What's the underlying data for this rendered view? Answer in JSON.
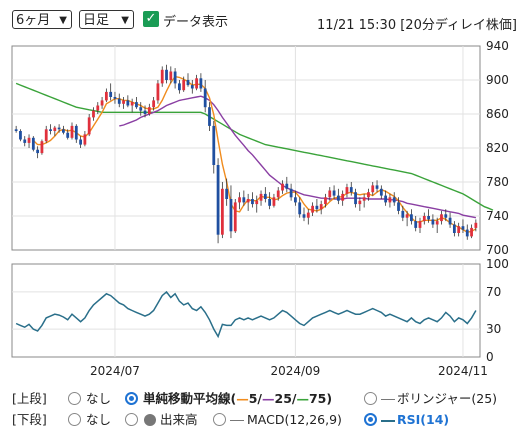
{
  "controls": {
    "period": "6ヶ月",
    "interval": "日足",
    "show_data_label": "データ表示",
    "show_data_checked": true,
    "timestamp": "11/21 15:30 [20分ディレイ株価]"
  },
  "legend": {
    "upper_label": "[上段]",
    "upper_none": "なし",
    "sma_label": "単純移動平均線(",
    "sma5": "5",
    "sma25": "25",
    "sma75": "75",
    "sma_sep1": "/",
    "sma_sep2": "/",
    "sma_close": ")",
    "bollinger": "ボリンジャー(25)",
    "lower_label": "[下段]",
    "lower_none": "なし",
    "volume": "出来高",
    "macd": "MACD(12,26,9)",
    "rsi": "RSI(14)"
  },
  "colors": {
    "up": "#e0303c",
    "down": "#1f4fa0",
    "ma5": "#f08c1e",
    "ma25": "#8a3fa3",
    "ma75": "#3aa33a",
    "rsi": "#2a6f8a",
    "accent": "#1f73d3"
  },
  "chart_data": [
    {
      "type": "candlestick",
      "y_ticks": [
        700,
        740,
        780,
        820,
        860,
        900,
        940
      ],
      "ylim": [
        700,
        940
      ],
      "x_ticks": [
        "2024/07",
        "2024/09",
        "2024/11"
      ],
      "x_tick_index": [
        23,
        65,
        104
      ],
      "candles": [
        [
          842,
          846,
          838,
          840
        ],
        [
          840,
          842,
          828,
          830
        ],
        [
          830,
          834,
          822,
          826
        ],
        [
          826,
          836,
          820,
          832
        ],
        [
          832,
          834,
          816,
          818
        ],
        [
          818,
          822,
          808,
          814
        ],
        [
          814,
          830,
          812,
          828
        ],
        [
          828,
          846,
          826,
          842
        ],
        [
          842,
          848,
          836,
          840
        ],
        [
          840,
          846,
          834,
          844
        ],
        [
          844,
          848,
          838,
          842
        ],
        [
          842,
          846,
          836,
          838
        ],
        [
          838,
          842,
          830,
          832
        ],
        [
          832,
          850,
          830,
          846
        ],
        [
          846,
          848,
          826,
          830
        ],
        [
          830,
          834,
          820,
          824
        ],
        [
          824,
          840,
          822,
          836
        ],
        [
          836,
          860,
          834,
          856
        ],
        [
          856,
          868,
          852,
          864
        ],
        [
          864,
          874,
          860,
          870
        ],
        [
          870,
          880,
          866,
          876
        ],
        [
          876,
          890,
          874,
          886
        ],
        [
          886,
          896,
          876,
          880
        ],
        [
          880,
          886,
          872,
          878
        ],
        [
          878,
          884,
          868,
          872
        ],
        [
          872,
          880,
          866,
          876
        ],
        [
          876,
          882,
          868,
          870
        ],
        [
          870,
          878,
          862,
          874
        ],
        [
          874,
          880,
          866,
          868
        ],
        [
          868,
          874,
          858,
          864
        ],
        [
          864,
          870,
          856,
          860
        ],
        [
          860,
          872,
          858,
          868
        ],
        [
          868,
          880,
          864,
          876
        ],
        [
          876,
          900,
          872,
          896
        ],
        [
          896,
          916,
          892,
          912
        ],
        [
          912,
          918,
          896,
          900
        ],
        [
          900,
          916,
          896,
          910
        ],
        [
          910,
          914,
          890,
          896
        ],
        [
          896,
          900,
          884,
          888
        ],
        [
          888,
          904,
          886,
          900
        ],
        [
          900,
          908,
          892,
          894
        ],
        [
          894,
          900,
          884,
          890
        ],
        [
          890,
          906,
          888,
          902
        ],
        [
          902,
          908,
          886,
          890
        ],
        [
          890,
          900,
          862,
          868
        ],
        [
          868,
          874,
          840,
          846
        ],
        [
          846,
          852,
          790,
          800
        ],
        [
          800,
          808,
          708,
          718
        ],
        [
          718,
          780,
          714,
          772
        ],
        [
          772,
          784,
          752,
          760
        ],
        [
          760,
          776,
          714,
          722
        ],
        [
          722,
          760,
          720,
          756
        ],
        [
          756,
          768,
          748,
          762
        ],
        [
          762,
          770,
          752,
          756
        ],
        [
          756,
          766,
          746,
          760
        ],
        [
          760,
          768,
          750,
          754
        ],
        [
          754,
          764,
          744,
          758
        ],
        [
          758,
          770,
          752,
          766
        ],
        [
          766,
          774,
          756,
          760
        ],
        [
          760,
          768,
          748,
          752
        ],
        [
          752,
          766,
          750,
          762
        ],
        [
          762,
          774,
          758,
          770
        ],
        [
          770,
          782,
          766,
          778
        ],
        [
          778,
          786,
          768,
          772
        ],
        [
          772,
          778,
          758,
          762
        ],
        [
          762,
          770,
          752,
          756
        ],
        [
          756,
          762,
          738,
          742
        ],
        [
          742,
          750,
          734,
          738
        ],
        [
          738,
          748,
          730,
          744
        ],
        [
          744,
          756,
          740,
          752
        ],
        [
          752,
          760,
          744,
          748
        ],
        [
          748,
          758,
          742,
          754
        ],
        [
          754,
          766,
          750,
          762
        ],
        [
          762,
          774,
          758,
          770
        ],
        [
          770,
          776,
          760,
          764
        ],
        [
          764,
          772,
          754,
          758
        ],
        [
          758,
          770,
          752,
          766
        ],
        [
          766,
          778,
          762,
          774
        ],
        [
          774,
          780,
          764,
          768
        ],
        [
          768,
          772,
          750,
          754
        ],
        [
          754,
          762,
          746,
          758
        ],
        [
          758,
          766,
          750,
          762
        ],
        [
          762,
          772,
          758,
          768
        ],
        [
          768,
          780,
          764,
          776
        ],
        [
          776,
          782,
          768,
          772
        ],
        [
          772,
          776,
          760,
          764
        ],
        [
          764,
          770,
          752,
          756
        ],
        [
          756,
          766,
          750,
          762
        ],
        [
          762,
          768,
          752,
          756
        ],
        [
          756,
          762,
          742,
          746
        ],
        [
          746,
          752,
          734,
          738
        ],
        [
          738,
          746,
          728,
          742
        ],
        [
          742,
          748,
          730,
          734
        ],
        [
          734,
          740,
          722,
          726
        ],
        [
          726,
          738,
          720,
          734
        ],
        [
          734,
          744,
          730,
          740
        ],
        [
          740,
          748,
          732,
          736
        ],
        [
          736,
          742,
          726,
          730
        ],
        [
          730,
          738,
          720,
          734
        ],
        [
          734,
          746,
          730,
          742
        ],
        [
          742,
          748,
          734,
          738
        ],
        [
          738,
          744,
          726,
          730
        ],
        [
          730,
          734,
          716,
          720
        ],
        [
          720,
          732,
          716,
          728
        ],
        [
          728,
          736,
          720,
          724
        ],
        [
          724,
          730,
          712,
          716
        ],
        [
          716,
          730,
          714,
          726
        ],
        [
          726,
          736,
          722,
          732
        ]
      ],
      "ma5": [
        null,
        null,
        null,
        null,
        829,
        824,
        824,
        826,
        829,
        834,
        840,
        842,
        840,
        841,
        838,
        834,
        833,
        838,
        846,
        854,
        862,
        872,
        875,
        878,
        878,
        876,
        876,
        874,
        872,
        870,
        867,
        866,
        866,
        868,
        876,
        887,
        897,
        904,
        903,
        901,
        898,
        894,
        895,
        895,
        890,
        879,
        859,
        829,
        801,
        780,
        754,
        746,
        745,
        753,
        759,
        758,
        758,
        763,
        762,
        762,
        759,
        760,
        764,
        767,
        768,
        768,
        762,
        754,
        748,
        747,
        746,
        748,
        752,
        757,
        761,
        762,
        763,
        767,
        768,
        766,
        765,
        766,
        766,
        764,
        768,
        771,
        769,
        766,
        763,
        758,
        750,
        744,
        738,
        733,
        733,
        735,
        735,
        735,
        735,
        738,
        736,
        732,
        729,
        727,
        724,
        721,
        722,
        725
      ],
      "ma25": [
        null,
        null,
        null,
        null,
        null,
        null,
        null,
        null,
        null,
        null,
        null,
        null,
        null,
        null,
        null,
        null,
        null,
        null,
        null,
        null,
        null,
        null,
        null,
        null,
        846,
        847,
        849,
        851,
        853,
        856,
        858,
        860,
        862,
        864,
        867,
        870,
        872,
        874,
        876,
        877,
        878,
        879,
        880,
        881,
        879,
        876,
        871,
        864,
        856,
        849,
        842,
        835,
        829,
        823,
        817,
        812,
        806,
        800,
        794,
        788,
        784,
        780,
        776,
        773,
        771,
        769,
        767,
        765,
        764,
        763,
        762,
        761,
        761,
        760,
        760,
        760,
        760,
        761,
        761,
        761,
        761,
        761,
        760,
        760,
        760,
        760,
        760,
        759,
        759,
        758,
        757,
        755,
        754,
        753,
        752,
        751,
        750,
        749,
        748,
        747,
        746,
        745,
        744,
        743,
        741,
        740,
        739,
        738
      ],
      "ma75": [
        896,
        894,
        892,
        890,
        888,
        886,
        884,
        882,
        880,
        878,
        876,
        874,
        872,
        870,
        868,
        867,
        866,
        865,
        864,
        863,
        862,
        862,
        862,
        862,
        862,
        862,
        862,
        862,
        862,
        862,
        862,
        862,
        862,
        862,
        862,
        862,
        862,
        862,
        862,
        862,
        862,
        862,
        862,
        862,
        860,
        857,
        854,
        851,
        848,
        845,
        842,
        839,
        836,
        834,
        832,
        830,
        828,
        826,
        824,
        823,
        822,
        821,
        820,
        819,
        818,
        817,
        816,
        815,
        814,
        813,
        812,
        811,
        810,
        809,
        808,
        807,
        806,
        805,
        804,
        803,
        802,
        801,
        800,
        799,
        798,
        797,
        796,
        795,
        794,
        793,
        792,
        791,
        790,
        788,
        786,
        784,
        782,
        780,
        778,
        776,
        774,
        772,
        770,
        768,
        766,
        763,
        760,
        757,
        754,
        751,
        749,
        747
      ],
      "rsi_ylim": [
        0,
        100
      ],
      "rsi_ticks": [
        0,
        30,
        70,
        100
      ],
      "rsi": [
        36,
        34,
        32,
        35,
        30,
        28,
        34,
        42,
        44,
        46,
        45,
        43,
        40,
        46,
        42,
        38,
        42,
        50,
        56,
        60,
        64,
        68,
        66,
        62,
        58,
        56,
        52,
        50,
        48,
        46,
        44,
        46,
        50,
        58,
        66,
        70,
        64,
        68,
        60,
        56,
        58,
        52,
        50,
        54,
        48,
        40,
        30,
        22,
        35,
        34,
        34,
        40,
        42,
        40,
        42,
        40,
        42,
        44,
        42,
        40,
        42,
        46,
        50,
        48,
        44,
        40,
        36,
        34,
        38,
        42,
        44,
        46,
        48,
        50,
        48,
        46,
        48,
        50,
        48,
        46,
        46,
        48,
        50,
        52,
        50,
        48,
        44,
        46,
        44,
        42,
        40,
        38,
        42,
        38,
        36,
        40,
        42,
        40,
        38,
        42,
        48,
        44,
        38,
        42,
        40,
        36,
        42,
        50
      ]
    }
  ]
}
